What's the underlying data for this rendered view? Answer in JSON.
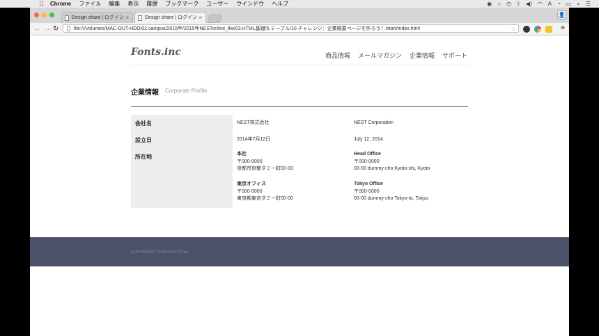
{
  "menubar": {
    "items": [
      "Chrome",
      "ファイル",
      "編集",
      "表示",
      "履歴",
      "ブックマーク",
      "ユーザー",
      "ウインドウ",
      "ヘルプ"
    ]
  },
  "browser": {
    "tabs": [
      {
        "label": "Design share | ログイン"
      },
      {
        "label": "Design share | ログイン"
      }
    ],
    "url": "file:///Volumes/MAC-OUT-HDD/02.campus/2015年/2015年NESTonline_file/03.HTML基礎/5.テーブル/10.チャレンジ：企業概要ページを作ろう！/start/index.html"
  },
  "site": {
    "logo": "Fonts.inc",
    "nav": [
      "商品情報",
      "メールマガジン",
      "企業情報",
      "サポート"
    ],
    "heading_ja": "企業情報",
    "heading_en": "Corporate Profile",
    "table": {
      "company_label": "会社名",
      "company_ja": "NEST株式会社",
      "company_en": "NEST Corporation",
      "founded_label": "設立日",
      "founded_ja": "2014年7月12日",
      "founded_en": "July 12, 2014",
      "address_label": "所在地",
      "hq_title_ja": "本社",
      "hq_zip_ja": "〒000-0000",
      "hq_addr_ja": "京都市京都ダミー町00-00",
      "hq_title_en": "Head Office",
      "hq_zip_en": "〒000-0000",
      "hq_addr_en": "00-00 dummy-cho Kyoto-shi, Kyoto",
      "tokyo_title_ja": "東京オフィス",
      "tokyo_zip_ja": "〒000-0000",
      "tokyo_addr_ja": "東京都東京ダミー町00-00",
      "tokyo_title_en": "Tokyo Office",
      "tokyo_zip_en": "〒000-0000",
      "tokyo_addr_en": "00-00 dummy-cho Tokyo-to, Tokyo"
    },
    "copyright": "COPYRIGHT 2015 FONTS.inc"
  },
  "colors": {
    "footer_bg": "#4b5168",
    "table_header_bg": "#eeeeee"
  }
}
